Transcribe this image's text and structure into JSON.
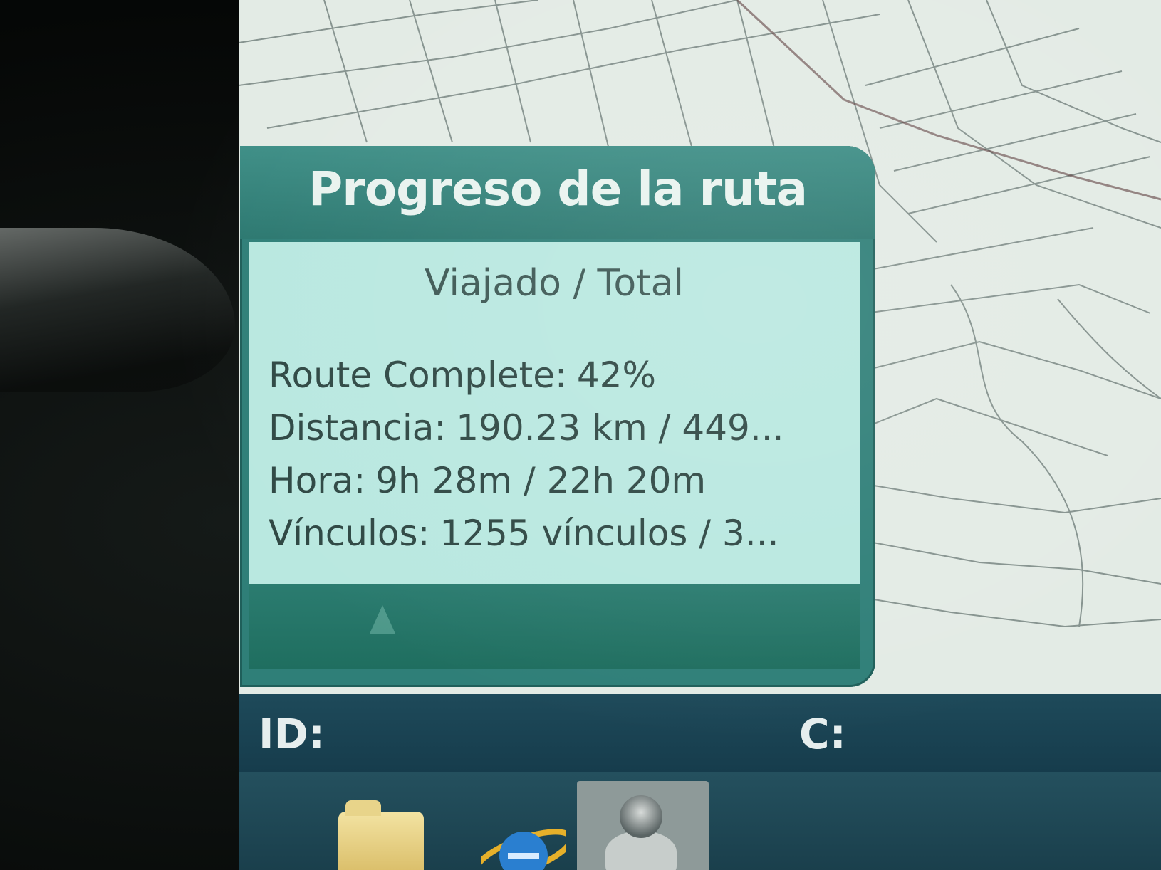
{
  "popup": {
    "title": "Progreso de la ruta",
    "column_header": "Viajado / Total",
    "stats": [
      {
        "label": "Route Complete:",
        "value": "42%"
      },
      {
        "label": "Distancia:",
        "value": "190.23 km / 449..."
      },
      {
        "label": "Hora:",
        "value": "9h 28m / 22h 20m"
      },
      {
        "label": "Vínculos:",
        "value": "1255 vínculos / 3..."
      }
    ]
  },
  "status_bar": {
    "id_label": "ID:",
    "c_label": "C:"
  },
  "taskbar": {
    "icons": [
      "folder-icon",
      "internet-explorer-icon",
      "navigation-app-icon"
    ]
  },
  "colors": {
    "popup_frame": "#2f7f78",
    "popup_body": "#b9e8e0",
    "status_bar": "#1e4a5a",
    "map_background": "#e3ebe5"
  }
}
